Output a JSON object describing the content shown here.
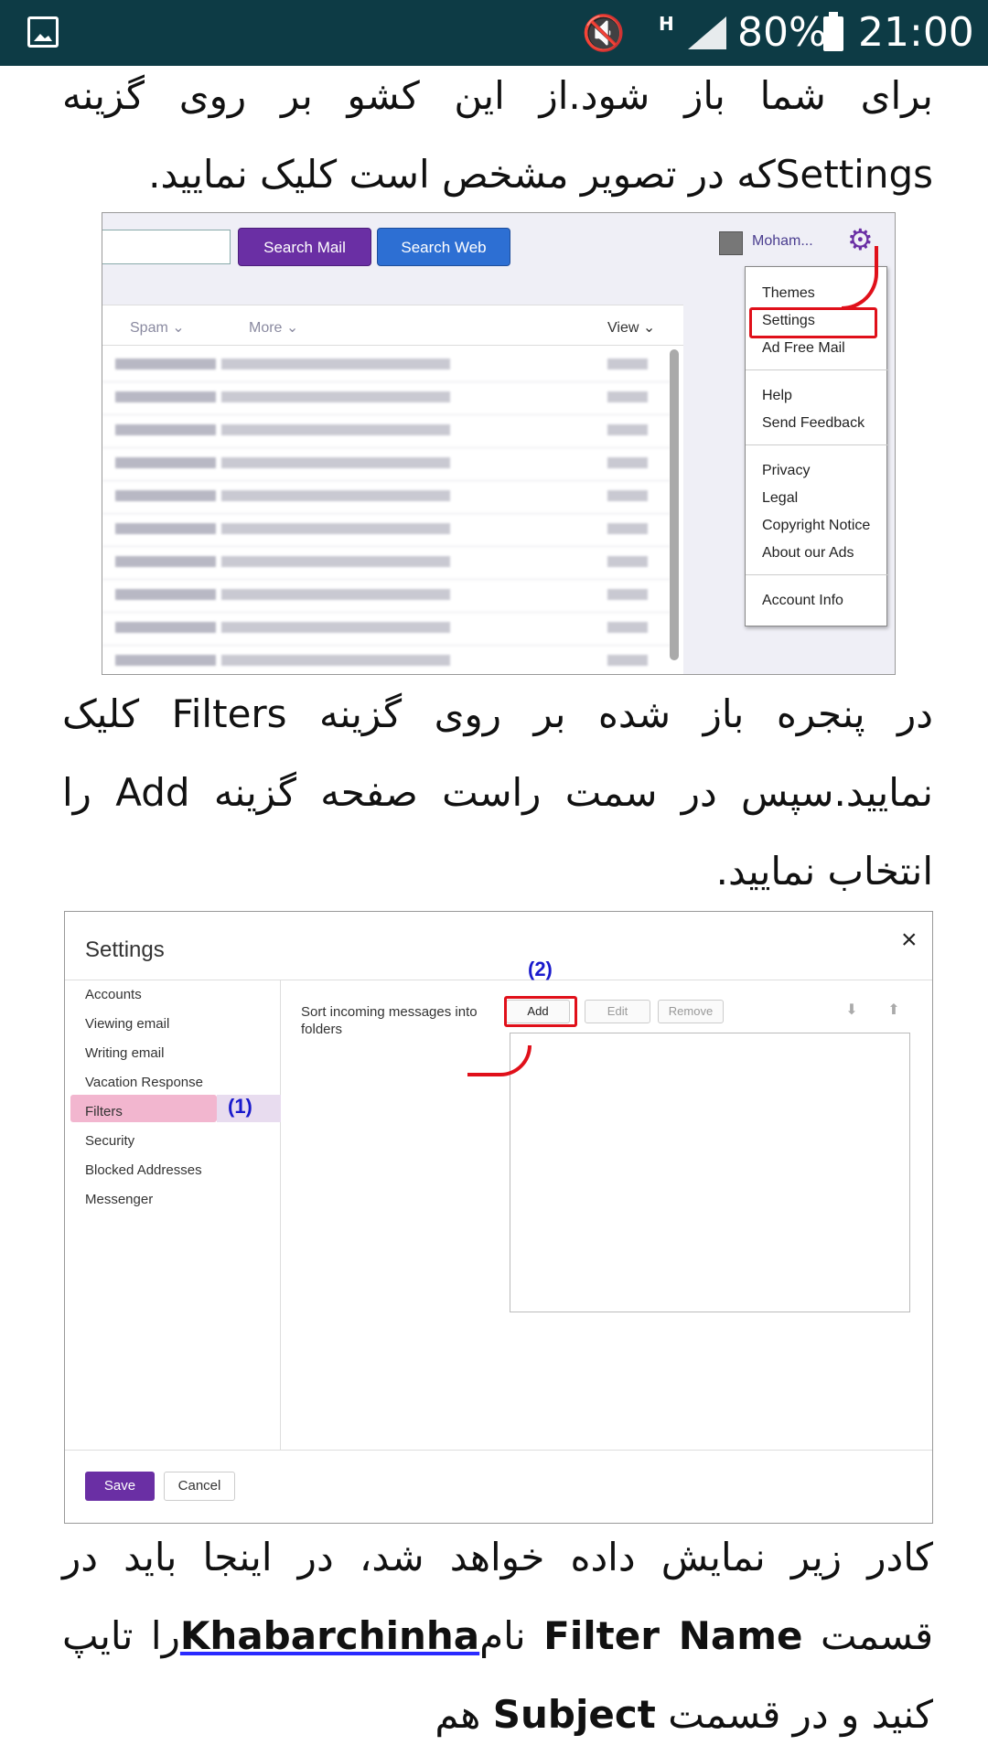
{
  "status_bar": {
    "battery_percent": "80%",
    "time": "21:00",
    "network": "H"
  },
  "paragraphs": {
    "p1": "برای شما باز شود.از این کشو بر روی گزینه Settingsکه در تصویر مشخص است کلیک نمایید.",
    "p2": "در پنجره باز شده بر روی گزینه Filters کلیک نمایید.سپس در سمت راست صفحه گزینه Add را انتخاب نمایید.",
    "p3_part1": "کادر زیر نمایش داده خواهد شد، در اینجا باید در قسمت ",
    "p3_filter_name": "Filter Name",
    "p3_part2": " نام",
    "p3_link": "Khabarchinha",
    "p3_part3": "را تایپ کنید و در قسمت ",
    "p3_subject": "Subject",
    "p3_part4": " هم"
  },
  "screenshot1": {
    "search_mail": "Search Mail",
    "search_web": "Search Web",
    "user_name": "Moham...",
    "spam": "Spam ⌄",
    "more": "More ⌄",
    "view": "View ⌄",
    "menu": {
      "themes": "Themes",
      "settings": "Settings",
      "ad_free": "Ad Free Mail",
      "help": "Help",
      "send_feedback": "Send Feedback",
      "privacy": "Privacy",
      "legal": "Legal",
      "copyright": "Copyright Notice",
      "about_ads": "About our Ads",
      "account_info": "Account Info"
    }
  },
  "screenshot2": {
    "title": "Settings",
    "close": "×",
    "nav": [
      "Accounts",
      "Viewing email",
      "Writing email",
      "Vacation Response",
      "Filters",
      "Security",
      "Blocked Addresses",
      "Messenger"
    ],
    "marker1": "(1)",
    "marker2": "(2)",
    "description": "Sort incoming messages into folders",
    "add": "Add",
    "edit": "Edit",
    "remove": "Remove",
    "save": "Save",
    "cancel": "Cancel"
  }
}
